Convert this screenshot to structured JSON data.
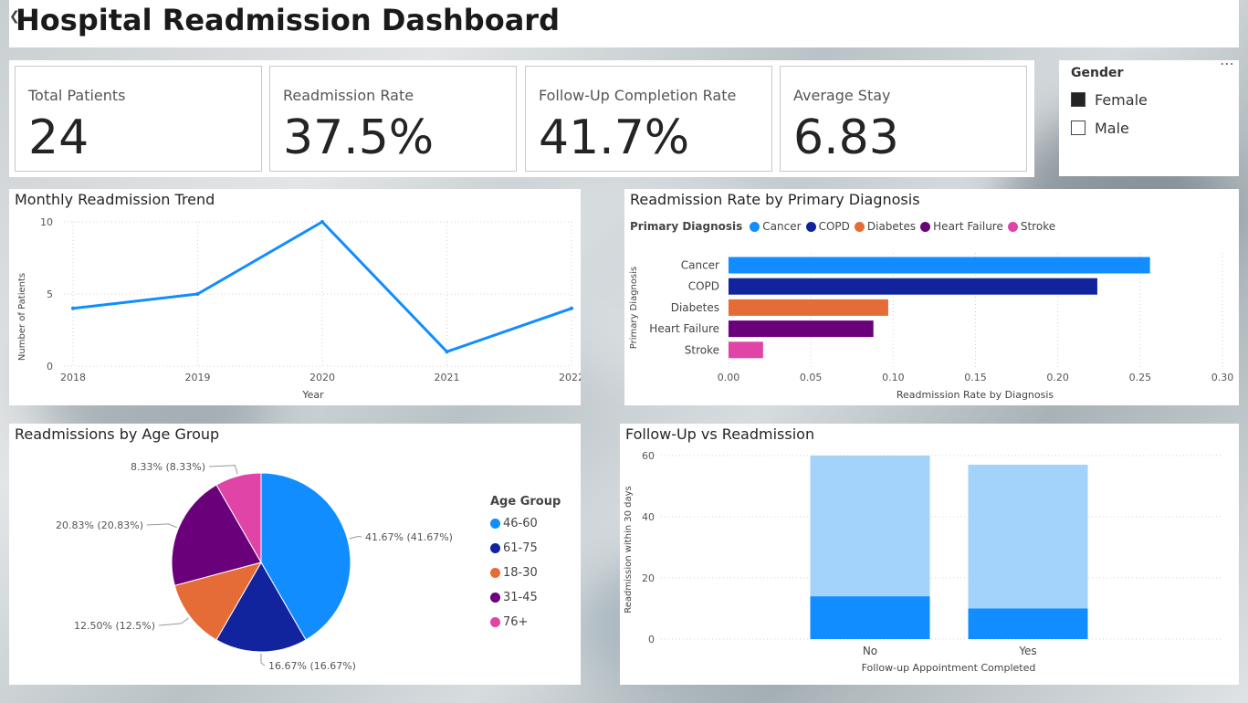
{
  "header": {
    "title": "Hospital Readmission Dashboard"
  },
  "kpis": [
    {
      "label": "Total Patients",
      "value": "24"
    },
    {
      "label": "Readmission Rate",
      "value": "37.5%"
    },
    {
      "label": "Follow-Up Completion Rate",
      "value": "41.7%"
    },
    {
      "label": "Average Stay",
      "value": "6.83"
    }
  ],
  "slicer": {
    "title": "Gender",
    "options": [
      {
        "label": "Female",
        "checked": true
      },
      {
        "label": "Male",
        "checked": false
      }
    ],
    "more_icon": "more-options-icon"
  },
  "colors": {
    "blue": "#118DFF",
    "navy": "#12239E",
    "orange": "#E66C37",
    "purple": "#6B007B",
    "pink": "#E044A7",
    "lightblue": "#A3D2FB"
  },
  "chart_data": [
    {
      "type": "line",
      "title": "Monthly Readmission Trend",
      "xlabel": "Year",
      "ylabel": "Number of Patients",
      "x": [
        "2018",
        "2019",
        "2020",
        "2021",
        "2022"
      ],
      "values": [
        4,
        5,
        10,
        1,
        4
      ],
      "ylim": [
        0,
        10
      ],
      "yticks": [
        "0",
        "5",
        "10"
      ],
      "grid": true
    },
    {
      "type": "bar",
      "title": "Readmission Rate by Primary Diagnosis",
      "legend_title": "Primary Diagnosis",
      "xlabel": "Readmission Rate by Diagnosis",
      "ylabel": "Primary Diagnosis",
      "categories": [
        "Cancer",
        "COPD",
        "Diabetes",
        "Heart Failure",
        "Stroke"
      ],
      "values": [
        0.256,
        0.224,
        0.097,
        0.088,
        0.021
      ],
      "xlim": [
        0,
        0.3
      ],
      "xticks": [
        "0.00",
        "0.05",
        "0.10",
        "0.15",
        "0.20",
        "0.25",
        "0.30"
      ],
      "legend": "top"
    },
    {
      "type": "pie",
      "title": "Readmissions by Age Group",
      "legend_title": "Age Group",
      "categories": [
        "46-60",
        "61-75",
        "18-30",
        "31-45",
        "76+"
      ],
      "values": [
        41.67,
        16.67,
        12.5,
        20.83,
        8.33
      ],
      "labels": [
        "41.67% (41.67%)",
        "16.67% (16.67%)",
        "12.50% (12.5%)",
        "20.83% (20.83%)",
        "8.33% (8.33%)"
      ],
      "legend": "right"
    },
    {
      "type": "bar",
      "title": "Follow-Up vs Readmission",
      "xlabel": "Follow-up Appointment Completed",
      "ylabel": "Readmission within 30 days",
      "categories": [
        "No",
        "Yes"
      ],
      "series": [
        {
          "values": [
            14,
            10
          ]
        },
        {
          "values": [
            46,
            47
          ]
        }
      ],
      "stacked": true,
      "ylim": [
        0,
        60
      ],
      "yticks": [
        "0",
        "20",
        "40",
        "60"
      ]
    }
  ]
}
